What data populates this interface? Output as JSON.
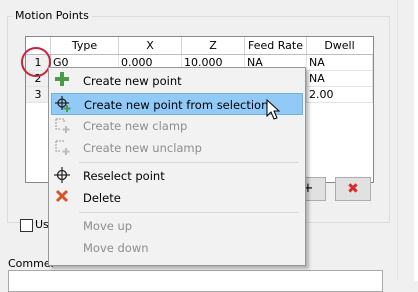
{
  "group": {
    "title": "Motion Points"
  },
  "grid": {
    "columns": [
      "",
      "Type",
      "X",
      "Z",
      "Feed Rate",
      "Dwell"
    ],
    "rows": [
      [
        "1",
        "G0",
        "0.000",
        "10.000",
        "NA",
        "NA"
      ],
      [
        "2",
        "",
        "",
        "",
        "",
        "NA"
      ],
      [
        "3",
        "",
        "",
        "",
        "",
        "2.00"
      ]
    ]
  },
  "context_menu": {
    "items": [
      {
        "label": "Create new point",
        "icon": "plus-icon",
        "enabled": true
      },
      {
        "label": "Create new point from selection",
        "icon": "crosshair-plus-icon",
        "enabled": true,
        "highlighted": true
      },
      {
        "label": "Create new clamp",
        "icon": "clamp-icon",
        "enabled": false
      },
      {
        "label": "Create new unclamp",
        "icon": "unclamp-icon",
        "enabled": false
      },
      {
        "label": "Reselect point",
        "icon": "crosshair-icon",
        "enabled": true
      },
      {
        "label": "Delete",
        "icon": "x-icon",
        "enabled": true
      },
      {
        "label": "Move up",
        "enabled": false
      },
      {
        "label": "Move down",
        "enabled": false
      }
    ]
  },
  "buttons": {
    "add_symbol": "+",
    "delete_symbol": "✖"
  },
  "checkbox": {
    "label": "Us"
  },
  "comment": {
    "label": "Commer"
  },
  "colors": {
    "highlight": "#91c9f7",
    "annotation_circle": "#c8243a",
    "delete_red": "#d92b2b",
    "plus_green": "#4a9a4a"
  }
}
